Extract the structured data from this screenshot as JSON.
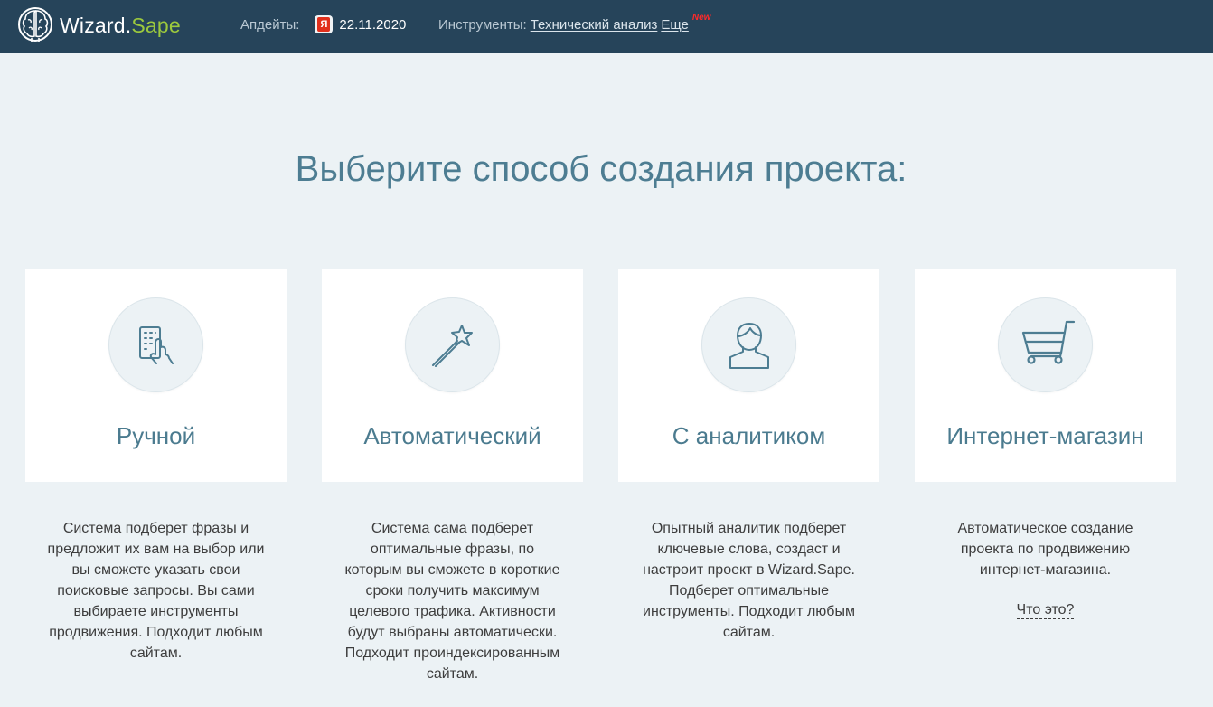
{
  "header": {
    "logo_main": "Wizard.",
    "logo_accent": "Sape",
    "updates_label": "Апдейты:",
    "yandex_badge": "Я",
    "updates_date": "22.11.2020",
    "tools_label": "Инструменты:",
    "tools_link": "Технический анализ",
    "more_link": "Еще",
    "new_badge": "New"
  },
  "title": "Выберите способ создания проекта:",
  "cards": [
    {
      "title": "Ручной",
      "icon": "hand-tap-icon",
      "desc_lines": [
        "Система подберет фразы и",
        "предложит их вам на выбор или",
        "вы сможете указать свои",
        "поисковые запросы. Вы сами",
        "выбираете инструменты",
        "продвижения. Подходит любым",
        "сайтам."
      ]
    },
    {
      "title": "Автоматический",
      "icon": "magic-wand-icon",
      "desc_lines": [
        "Система сама подберет",
        "оптимальные фразы, по",
        "которым вы сможете в короткие",
        "сроки получить максимум",
        "целевого трафика. Активности",
        "будут выбраны автоматически.",
        "Подходит проиндексированным",
        "сайтам."
      ]
    },
    {
      "title": "С аналитиком",
      "icon": "person-icon",
      "desc_lines": [
        "Опытный аналитик подберет",
        "ключевые слова, создаст и",
        "настроит проект в Wizard.Sape.",
        "Подберет оптимальные",
        "инструменты. Подходит любым",
        "сайтам."
      ]
    },
    {
      "title": "Интернет-магазин",
      "icon": "shopping-cart-icon",
      "desc_lines": [
        "Автоматическое создание",
        "проекта по продвижению",
        "интернет-магазина."
      ],
      "link": "Что это?"
    }
  ],
  "colors": {
    "topbar": "#26445a",
    "background": "#ecf2f5",
    "accent_green": "#9cc93d",
    "title": "#4d7d92",
    "icon_stroke": "#4d7d92",
    "new_badge": "#ff2a2a"
  }
}
